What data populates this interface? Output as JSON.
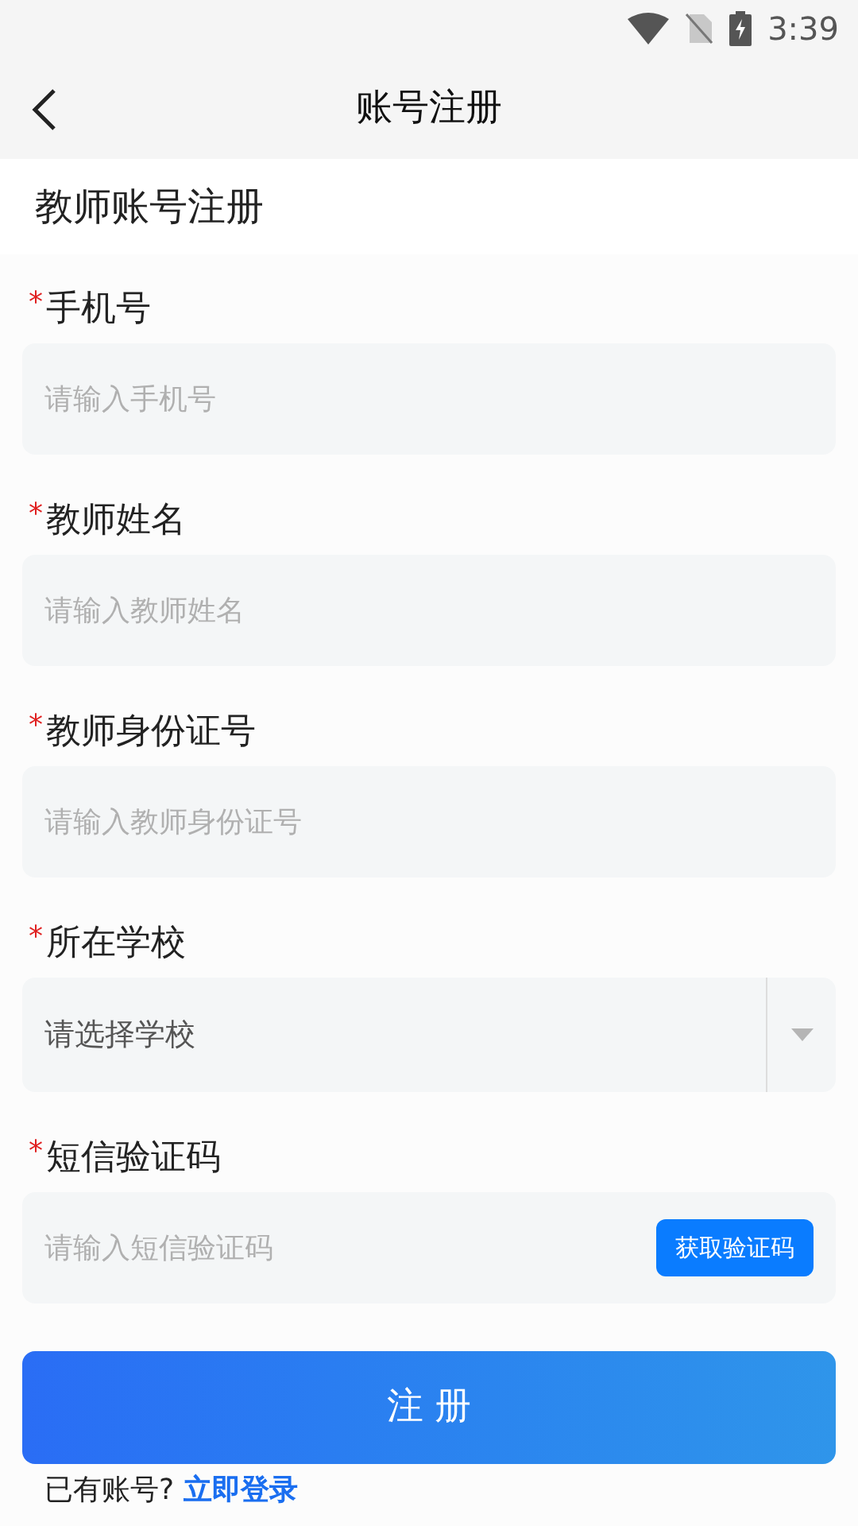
{
  "status_bar": {
    "time": "3:39"
  },
  "header": {
    "title": "账号注册"
  },
  "section_title": "教师账号注册",
  "fields": [
    {
      "kind": "text",
      "required_mark": "*",
      "label": "手机号",
      "placeholder": "请输入手机号"
    },
    {
      "kind": "text",
      "required_mark": "*",
      "label": "教师姓名",
      "placeholder": "请输入教师姓名"
    },
    {
      "kind": "text",
      "required_mark": "*",
      "label": "教师身份证号",
      "placeholder": "请输入教师身份证号"
    },
    {
      "kind": "select",
      "required_mark": "*",
      "label": "所在学校",
      "placeholder": "请选择学校"
    },
    {
      "kind": "sms",
      "required_mark": "*",
      "label": "短信验证码",
      "placeholder": "请输入短信验证码",
      "button": "获取验证码"
    }
  ],
  "submit": "注 册",
  "footer": {
    "prompt": "已有账号?",
    "link": "立即登录"
  }
}
